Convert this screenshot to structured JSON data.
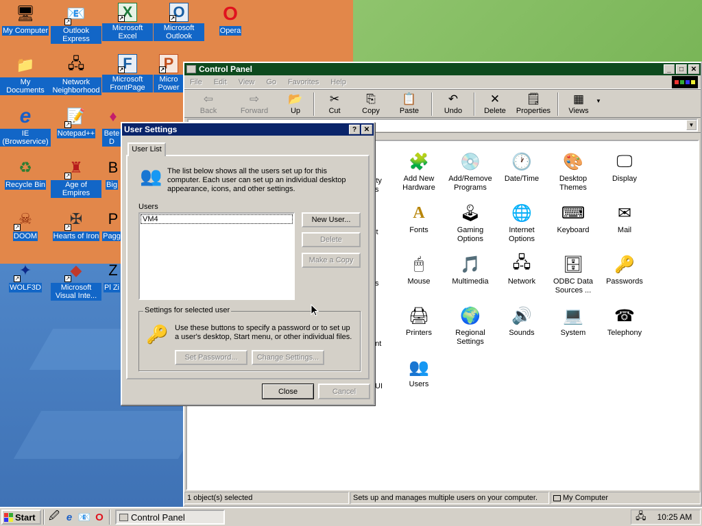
{
  "desktop": {
    "icons": [
      {
        "label": "My Computer",
        "glyph": "🖥"
      },
      {
        "label": "Outlook Express",
        "glyph": "📧"
      },
      {
        "label": "Microsoft Excel",
        "glyph": "X"
      },
      {
        "label": "Microsoft Outlook",
        "glyph": "O"
      },
      {
        "label": "Opera",
        "glyph": "O"
      },
      {
        "label": "My Documents",
        "glyph": "📁"
      },
      {
        "label": "Network Neighborhood",
        "glyph": "🖧"
      },
      {
        "label": "Microsoft FrontPage",
        "glyph": "F"
      },
      {
        "label": "Micro Power",
        "glyph": "P"
      },
      {
        "label": "IE (Browservice)",
        "glyph": "e"
      },
      {
        "label": "Notepad++",
        "glyph": "📝"
      },
      {
        "label": "Bete D",
        "glyph": "♦"
      },
      {
        "label": "Recycle Bin",
        "glyph": "♻"
      },
      {
        "label": "Age of Empires",
        "glyph": "♜"
      },
      {
        "label": "Big",
        "glyph": "B"
      },
      {
        "label": "DOOM",
        "glyph": "☠"
      },
      {
        "label": "Hearts of Iron",
        "glyph": "✠"
      },
      {
        "label": "Pagg",
        "glyph": "P"
      },
      {
        "label": "WOLF3D",
        "glyph": "✦"
      },
      {
        "label": "Microsoft Visual Inte...",
        "glyph": "◆"
      },
      {
        "label": "Pl Zi",
        "glyph": "Z"
      }
    ]
  },
  "control_panel": {
    "title": "Control Panel",
    "menu": [
      "File",
      "Edit",
      "View",
      "Go",
      "Favorites",
      "Help"
    ],
    "toolbar": {
      "back": "Back",
      "forward": "Forward",
      "up": "Up",
      "cut": "Cut",
      "copy": "Copy",
      "paste": "Paste",
      "undo": "Undo",
      "delete": "Delete",
      "properties": "Properties",
      "views": "Views"
    },
    "items": [
      {
        "label": "Add New Hardware",
        "glyph": "🧩"
      },
      {
        "label": "Add/Remove Programs",
        "glyph": "💿"
      },
      {
        "label": "Date/Time",
        "glyph": "🕐"
      },
      {
        "label": "Desktop Themes",
        "glyph": "🎨"
      },
      {
        "label": "Display",
        "glyph": "🖵"
      },
      {
        "label": "Fonts",
        "glyph": "A"
      },
      {
        "label": "Gaming Options",
        "glyph": "🕹"
      },
      {
        "label": "Internet Options",
        "glyph": "🌐"
      },
      {
        "label": "Keyboard",
        "glyph": "⌨"
      },
      {
        "label": "Mail",
        "glyph": "✉"
      },
      {
        "label": "Mouse",
        "glyph": "🖱"
      },
      {
        "label": "Multimedia",
        "glyph": "🎵"
      },
      {
        "label": "Network",
        "glyph": "🖧"
      },
      {
        "label": "ODBC Data Sources ...",
        "glyph": "🗄"
      },
      {
        "label": "Passwords",
        "glyph": "🔑"
      },
      {
        "label": "Printers",
        "glyph": "🖨"
      },
      {
        "label": "Regional Settings",
        "glyph": "🌍"
      },
      {
        "label": "Sounds",
        "glyph": "🔊"
      },
      {
        "label": "System",
        "glyph": "💻"
      },
      {
        "label": "Telephony",
        "glyph": "☎"
      },
      {
        "label": "Users",
        "glyph": "👥"
      }
    ],
    "partial_labels": [
      "ility",
      "s",
      "st",
      "s",
      "ent",
      "UI"
    ],
    "status": {
      "left": "1 object(s) selected",
      "middle": "Sets up and manages multiple users on your computer.",
      "right": "My Computer"
    }
  },
  "user_settings": {
    "title": "User Settings",
    "tab": "User List",
    "description": "The list below shows all the users set up for this computer. Each user can set up an individual desktop appearance, icons, and other settings.",
    "users_label": "Users",
    "users": [
      "VM4"
    ],
    "buttons": {
      "new_user": "New User...",
      "delete": "Delete",
      "make_copy": "Make a Copy",
      "set_password": "Set Password...",
      "change_settings": "Change Settings...",
      "close": "Close",
      "cancel": "Cancel"
    },
    "group_label": "Settings for selected user",
    "group_text": "Use these buttons to specify a password or to set up a user's desktop, Start menu, or other individual files."
  },
  "taskbar": {
    "start": "Start",
    "task_control_panel": "Control Panel",
    "clock": "10:25 AM"
  },
  "colors": {
    "title_active": "#0a246a",
    "cp_title": "#0d4a1e",
    "face": "#d4d0c8",
    "desktop_label": "#1266c7"
  }
}
